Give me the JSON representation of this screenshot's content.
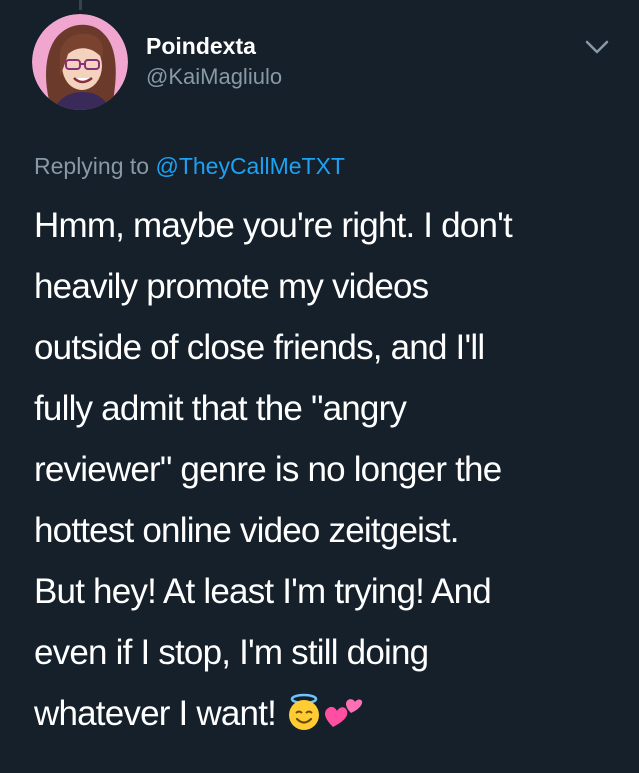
{
  "author": {
    "display_name": "Poindexta",
    "handle": "@KaiMagliulo",
    "avatar_bg": "#f0a6cf"
  },
  "reply": {
    "prefix": "Replying to ",
    "mention": "@TheyCallMeTXT"
  },
  "tweet": {
    "lines": [
      "Hmm, maybe you're right. I don't",
      "heavily promote my videos",
      "outside of close friends, and I'll",
      "fully admit that the \"angry",
      "reviewer\" genre is no longer the",
      "hottest online video zeitgeist.",
      "But hey! At least I'm trying! And",
      "even if I stop, I'm still doing",
      "whatever I want!"
    ],
    "emojis": [
      "smiling-face-with-halo",
      "two-hearts"
    ]
  },
  "colors": {
    "background": "#15202b",
    "text": "#ffffff",
    "secondary": "#8899a6",
    "link": "#1da1f2"
  }
}
